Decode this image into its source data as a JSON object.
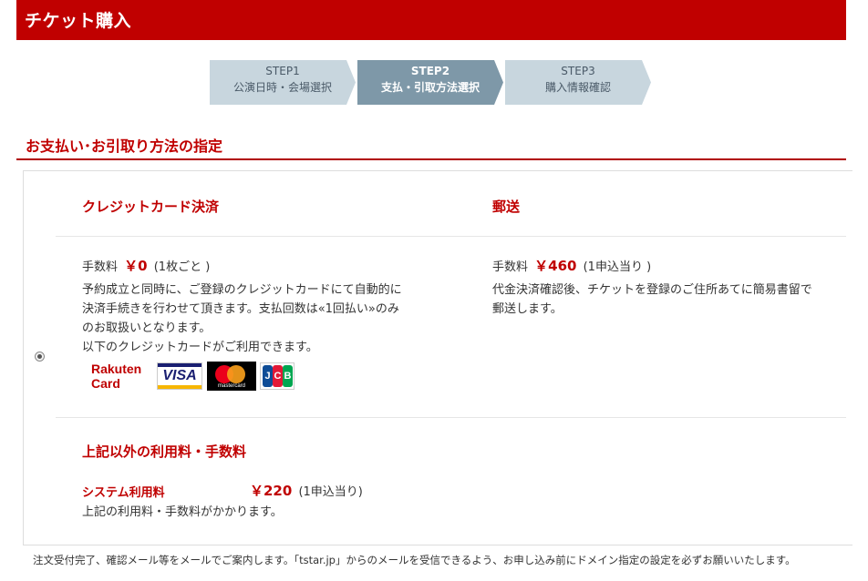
{
  "header": {
    "title": "チケット購入"
  },
  "steps": [
    {
      "num": "STEP1",
      "label": "公演日時・会場選択"
    },
    {
      "num": "STEP2",
      "label": "支払・引取方法選択"
    },
    {
      "num": "STEP3",
      "label": "購入情報確認"
    }
  ],
  "section": {
    "title": "お支払い･お引取り方法の指定"
  },
  "option": {
    "selected": true,
    "payment": {
      "title": "クレジットカード決済",
      "fee_label": "手数料",
      "fee_amount": "￥0",
      "fee_unit": "(1枚ごと )",
      "desc1": "予約成立と同時に、ご登録のクレジットカードにて自動的に",
      "desc2": "決済手続きを行わせて頂きます。支払回数は«1回払い»のみ",
      "desc3": "のお取扱いとなります。",
      "desc4": "以下のクレジットカードがご利用できます。",
      "cards": {
        "rakuten_line1": "Rakuten",
        "rakuten_line2": "Card",
        "visa": "VISA",
        "mastercard": "mastercard",
        "jcb_j": "J",
        "jcb_c": "C",
        "jcb_b": "B"
      }
    },
    "delivery": {
      "title": "郵送",
      "fee_label": "手数料",
      "fee_amount": "￥460",
      "fee_unit": "(1申込当り )",
      "desc1": "代金決済確認後、チケットを登録のご住所あてに簡易書留で",
      "desc2": "郵送します。"
    },
    "other": {
      "title": "上記以外の利用料・手数料",
      "system_label": "システム利用料",
      "system_amount": "￥220",
      "system_unit": "(1申込当り)",
      "desc": "上記の利用料・手数料がかかります。"
    }
  },
  "footer": {
    "note": "注文受付完了、確認メール等をメールでご案内します。「tstar.jp」からのメールを受信できるよう、お申し込み前にドメイン指定の設定を必ずお願いいたします。"
  },
  "colors": {
    "brand": "#c00000",
    "step_active": "#7e98a8",
    "step_inactive": "#c8d6de"
  }
}
